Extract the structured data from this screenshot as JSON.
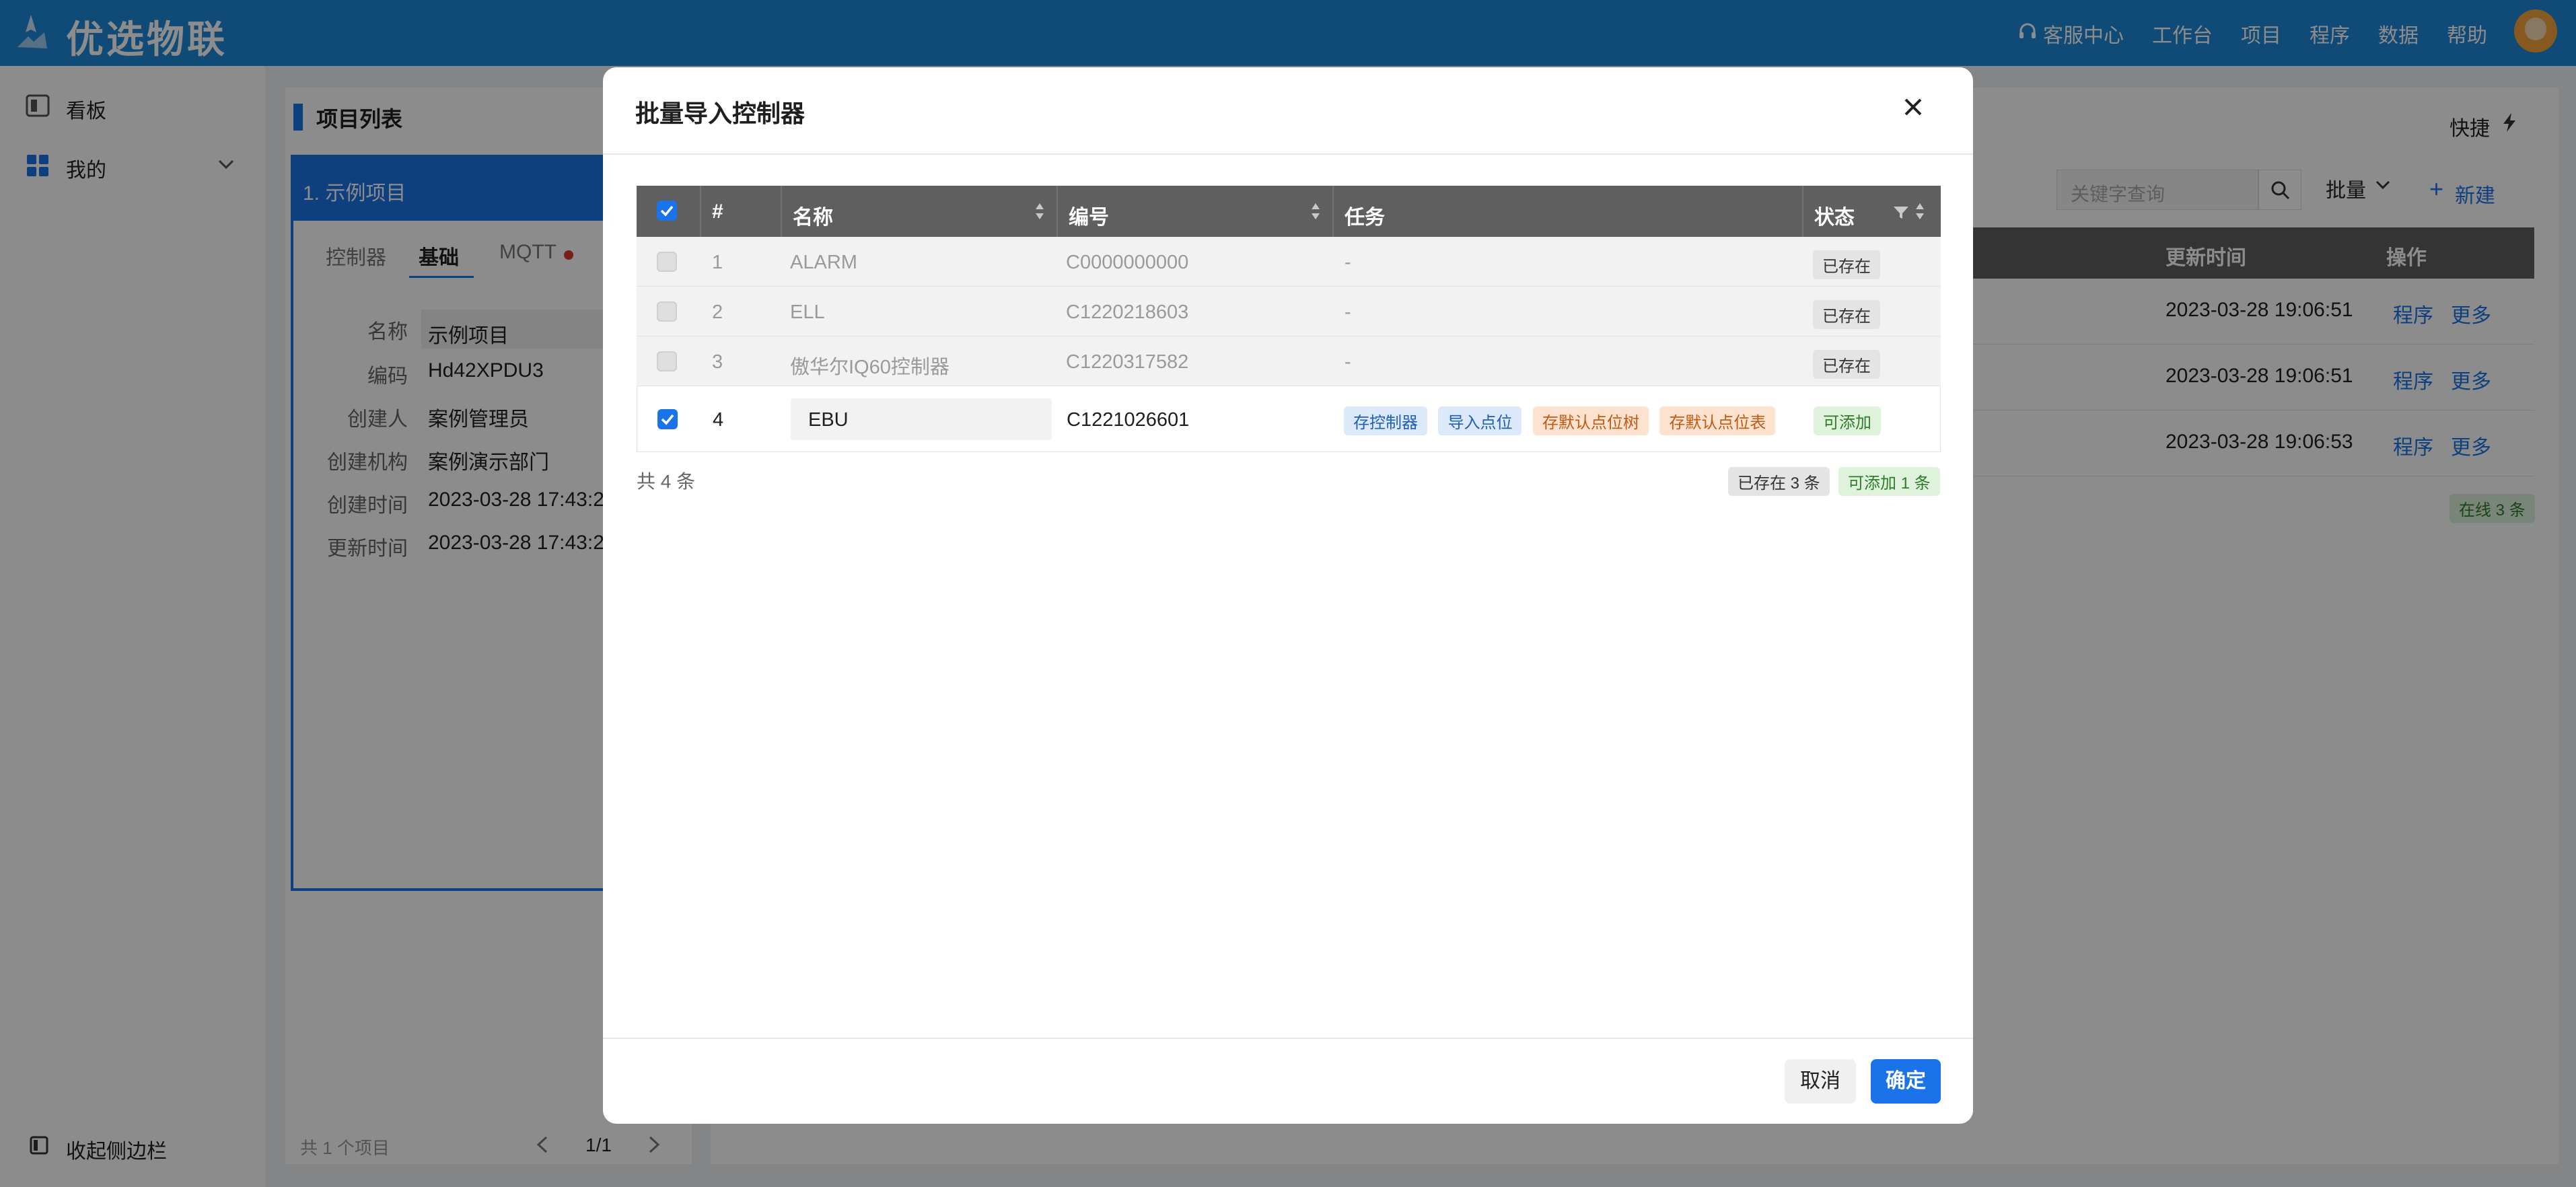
{
  "header": {
    "app_name": "优选物联",
    "nav": [
      "客服中心",
      "工作台",
      "项目",
      "程序",
      "数据",
      "帮助"
    ]
  },
  "sidebar": {
    "items": [
      {
        "label": "看板"
      },
      {
        "label": "我的"
      }
    ],
    "collapse_label": "收起侧边栏"
  },
  "project_list": {
    "title": "项目列表",
    "selected_item": "1. 示例项目",
    "tabs": [
      "控制器",
      "基础",
      "MQTT"
    ],
    "fields": [
      {
        "label": "名称",
        "value": "示例项目"
      },
      {
        "label": "编码",
        "value": "Hd42XPDU3"
      },
      {
        "label": "创建人",
        "value": "案例管理员"
      },
      {
        "label": "创建机构",
        "value": "案例演示部门"
      },
      {
        "label": "创建时间",
        "value": "2023-03-28 17:43:2"
      },
      {
        "label": "更新时间",
        "value": "2023-03-28 17:43:2"
      }
    ],
    "footer_count": "共 1 个项目",
    "pager": "1/1"
  },
  "right_panel": {
    "quick_label": "快捷",
    "search_placeholder": "关键字查询",
    "batch_label": "批量",
    "new_label": "新建",
    "columns": [
      "更新时间",
      "操作"
    ],
    "rows": [
      {
        "time": "2023-03-28 19:06:51",
        "op1": "程序",
        "op2": "更多"
      },
      {
        "time": "2023-03-28 19:06:51",
        "op1": "程序",
        "op2": "更多"
      },
      {
        "time": "2023-03-28 19:06:53",
        "op1": "程序",
        "op2": "更多"
      }
    ],
    "online_badge": "在线 3 条"
  },
  "modal": {
    "title": "批量导入控制器",
    "columns": [
      "#",
      "名称",
      "编号",
      "任务",
      "状态"
    ],
    "rows": [
      {
        "index": "1",
        "name": "ALARM",
        "code": "C0000000000",
        "task": "-",
        "status": "已存在",
        "checked": false
      },
      {
        "index": "2",
        "name": "ELL",
        "code": "C1220218603",
        "task": "-",
        "status": "已存在",
        "checked": false
      },
      {
        "index": "3",
        "name": "傲华尔IQ60控制器",
        "code": "C1220317582",
        "task": "-",
        "status": "已存在",
        "checked": false
      },
      {
        "index": "4",
        "name": "EBU",
        "code": "C1221026601",
        "tasks": [
          "存控制器",
          "导入点位",
          "存默认点位树",
          "存默认点位表"
        ],
        "status": "可添加",
        "checked": true
      }
    ],
    "total": "共 4 条",
    "summary_exist": "已存在 3 条",
    "summary_add": "可添加 1 条",
    "cancel_label": "取消",
    "ok_label": "确定"
  },
  "colors": {
    "header_bg": "#1e88d8",
    "accent": "#1a73e8",
    "table_header": "#5f5f5f"
  }
}
